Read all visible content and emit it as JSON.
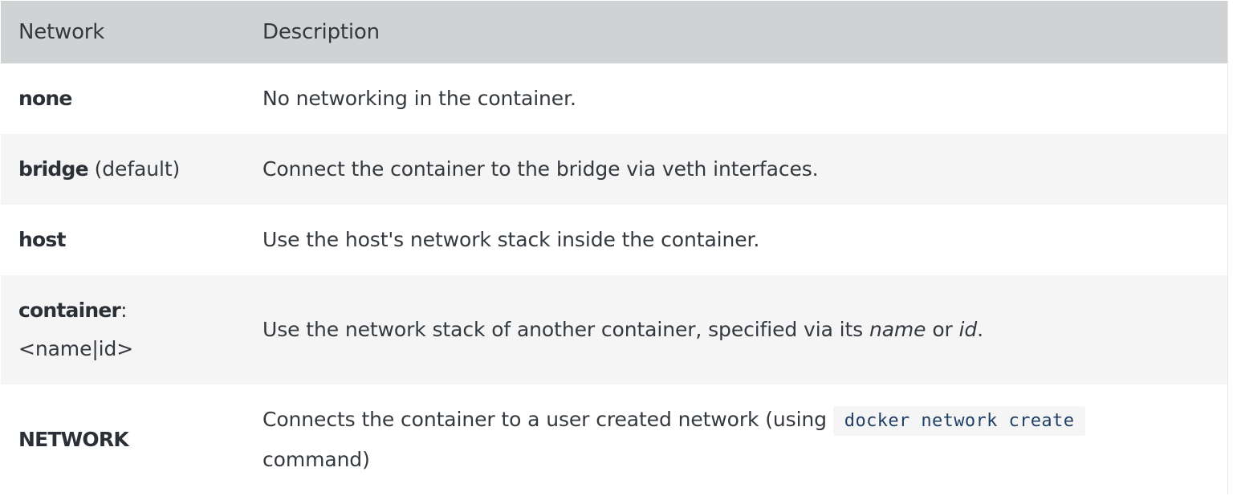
{
  "table": {
    "headers": {
      "network": "Network",
      "description": "Description"
    },
    "rows": [
      {
        "name": "none",
        "description": "No networking in the container."
      },
      {
        "name": "bridge",
        "name_suffix": "(default)",
        "description": "Connect the container to the bridge via veth interfaces."
      },
      {
        "name": "host",
        "description": "Use the host's network stack inside the container."
      },
      {
        "name": "container",
        "name_suffix": ":",
        "name_line2": "<name|id>",
        "description_parts": {
          "before": "Use the network stack of another container, specified via its ",
          "em1": "name",
          "mid": " or ",
          "em2": "id",
          "after": "."
        }
      },
      {
        "name": "NETWORK",
        "description_parts": {
          "before": "Connects the container to a user created network (using ",
          "code": "docker network create",
          "after": "command)"
        }
      }
    ]
  }
}
